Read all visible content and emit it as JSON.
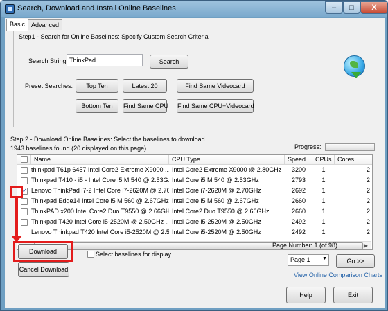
{
  "window": {
    "title": "Search, Download and Install Online Baselines",
    "minimize": "–",
    "maximize": "□",
    "close": "X"
  },
  "tabs": [
    "Basic",
    "Advanced"
  ],
  "step1": {
    "heading": "Step1 - Search for Online Baselines: Specify Custom Search Criteria",
    "search_label": "Search String",
    "search_value": "ThinkPad",
    "search_button": "Search",
    "preset_label": "Preset Searches:",
    "buttons": [
      "Top Ten",
      "Latest 20",
      "Find Same Videocard",
      "Bottom Ten",
      "Find Same CPU",
      "Find Same CPU+Videocard"
    ]
  },
  "step2": {
    "heading": "Step 2 - Download Online Baselines: Select the baselines to download",
    "found": "1943 baselines found (20 displayed on this page).",
    "progress_label": "Progress:",
    "progress_value": 0
  },
  "table": {
    "headers": [
      "Name",
      "CPU Type",
      "Speed",
      "CPUs",
      "Cores..."
    ],
    "rows": [
      {
        "checked": false,
        "name": "thinkpad T61p 6457 Intel Core2 Extreme X9000 ...",
        "cpu": "Intel Core2 Extreme X9000 @ 2.80GHz",
        "speed": "3200",
        "cpus": "1",
        "cores": "2"
      },
      {
        "checked": false,
        "name": "Thinkpad T410 - i5 - Intel Core i5 M 540 @ 2.53G...",
        "cpu": "Intel Core i5 M 540 @ 2.53GHz",
        "speed": "2793",
        "cpus": "1",
        "cores": "2"
      },
      {
        "checked": true,
        "name": "Lenovo ThinkPad i7-2 Intel Core i7-2620M @ 2.70...",
        "cpu": "Intel Core i7-2620M @ 2.70GHz",
        "speed": "2692",
        "cpus": "1",
        "cores": "2"
      },
      {
        "checked": false,
        "name": "Thinkpad Edge14 Intel Core i5 M 560 @ 2.67GHz ...",
        "cpu": "Intel Core i5 M 560 @ 2.67GHz",
        "speed": "2660",
        "cpus": "1",
        "cores": "2"
      },
      {
        "checked": false,
        "name": "ThinkPAD x200 Intel Core2 Duo T9550 @ 2.66GH...",
        "cpu": "Intel Core2 Duo T9550 @ 2.66GHz",
        "speed": "2660",
        "cpus": "1",
        "cores": "2"
      },
      {
        "checked": false,
        "name": "Thinkpad T420 Intel Core i5-2520M @ 2.50GHz ...",
        "cpu": "Intel Core i5-2520M @ 2.50GHz",
        "speed": "2492",
        "cpus": "1",
        "cores": "2"
      },
      {
        "checked": false,
        "name": "Lenovo Thinkpad T420 Intel Core i5-2520M @ 2.5...",
        "cpu": "Intel Core i5-2520M @ 2.50GHz",
        "speed": "2492",
        "cpus": "1",
        "cores": "2"
      }
    ]
  },
  "controls": {
    "download": "Download",
    "cancel": "Cancel Download",
    "select_display": "Select baselines for display",
    "page_number": "Page Number: 1 (of 98)",
    "page_select": "Page 1",
    "go": "Go >>",
    "view_charts": "View Online Comparison Charts",
    "help": "Help",
    "exit": "Exit"
  }
}
